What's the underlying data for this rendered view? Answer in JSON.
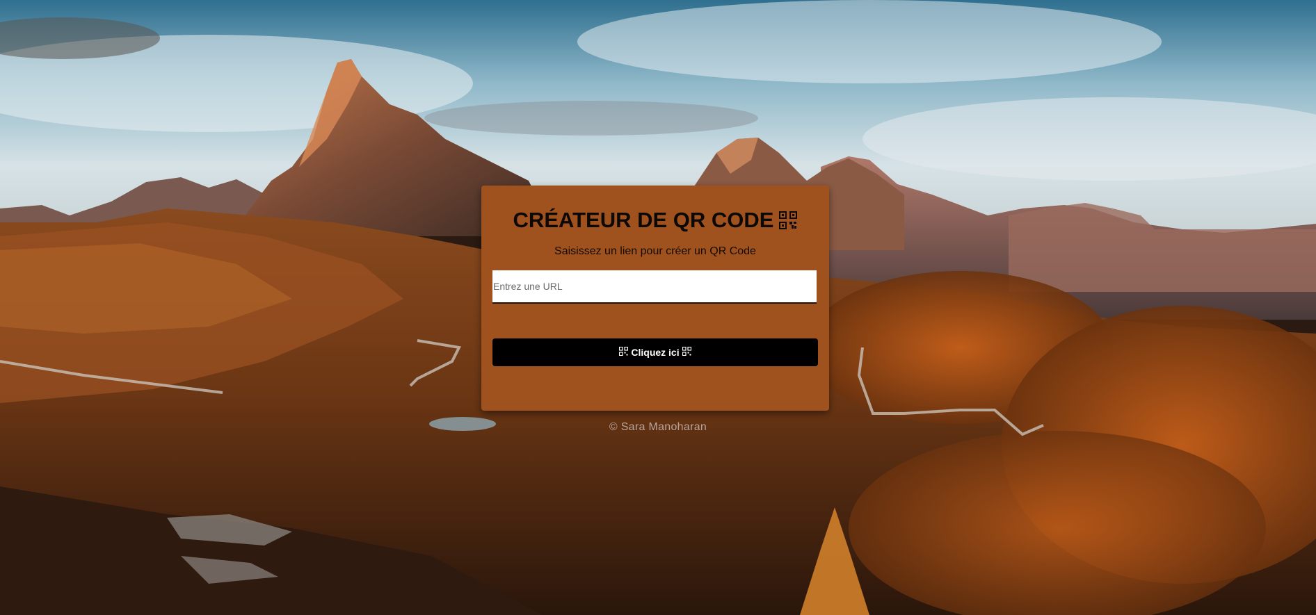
{
  "card": {
    "title": "CRÉATEUR DE QR CODE",
    "title_icon": "qr-code-icon",
    "subtitle": "Saisissez un lien pour créer un QR Code",
    "input_placeholder": "Entrez une URL",
    "input_value": "",
    "button_label": "Cliquez ici",
    "button_icon": "qr-code-icon"
  },
  "footer": {
    "text": "© Sara Manoharan"
  },
  "colors": {
    "card": "#a0521e",
    "button": "#000000",
    "button_text": "#ffffff",
    "sky": "#4a8fb0",
    "ground": "#8a4a1c"
  }
}
